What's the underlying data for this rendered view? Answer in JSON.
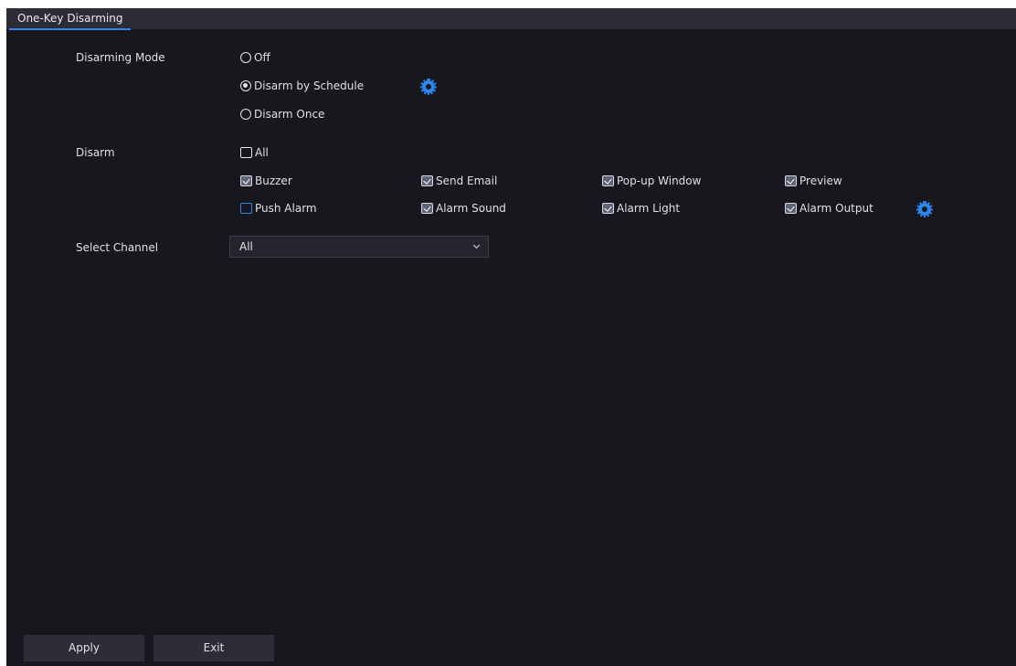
{
  "tab": {
    "title": "One-Key Disarming"
  },
  "disarming_mode": {
    "label": "Disarming Mode",
    "options": [
      {
        "label": "Off",
        "checked": false
      },
      {
        "label": "Disarm by Schedule",
        "checked": true
      },
      {
        "label": "Disarm Once",
        "checked": false
      }
    ]
  },
  "disarm": {
    "label": "Disarm",
    "all": {
      "label": "All",
      "checked": false
    },
    "items": [
      {
        "label": "Buzzer",
        "checked": true
      },
      {
        "label": "Send Email",
        "checked": true
      },
      {
        "label": "Pop-up Window",
        "checked": true
      },
      {
        "label": "Preview",
        "checked": true
      },
      {
        "label": "Push Alarm",
        "checked": false
      },
      {
        "label": "Alarm Sound",
        "checked": true
      },
      {
        "label": "Alarm Light",
        "checked": true
      },
      {
        "label": "Alarm Output",
        "checked": true
      }
    ]
  },
  "select_channel": {
    "label": "Select Channel",
    "value": "All"
  },
  "footer": {
    "apply_label": "Apply",
    "exit_label": "Exit"
  },
  "icons": {
    "settings": "gear-icon",
    "dropdown": "chevron-down-icon"
  },
  "colors": {
    "accent": "#2d86f0",
    "background": "#17171d",
    "panel": "#2b2c35"
  }
}
